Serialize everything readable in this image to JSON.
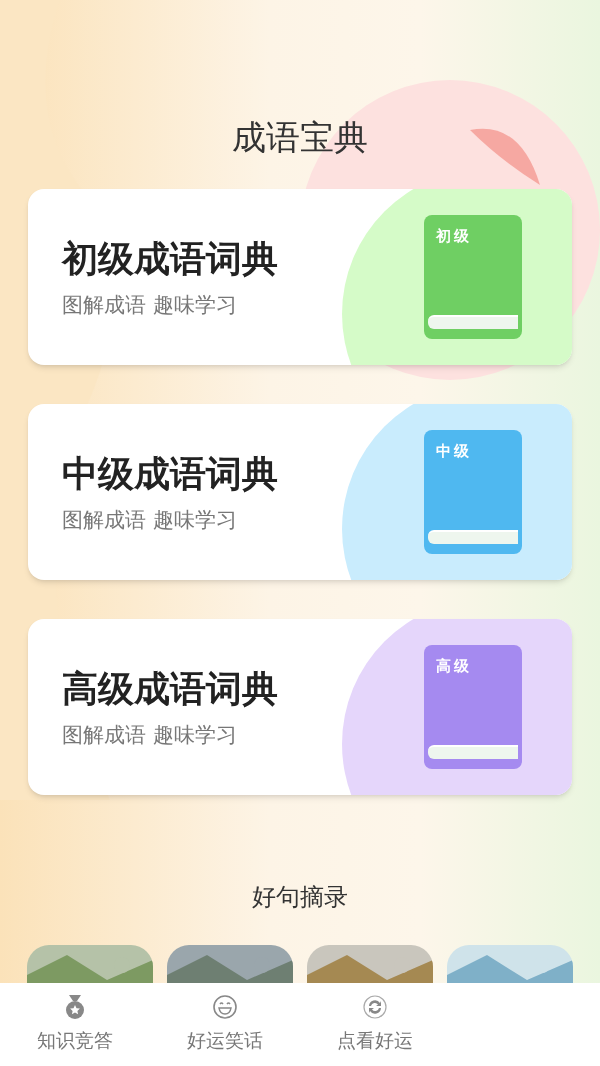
{
  "title": "成语宝典",
  "cards": [
    {
      "title": "初级成语词典",
      "subtitle": "图解成语 趣味学习",
      "book_label": "初级",
      "color": "#6fcf63"
    },
    {
      "title": "中级成语词典",
      "subtitle": "图解成语 趣味学习",
      "book_label": "中级",
      "color": "#4fb8f0"
    },
    {
      "title": "高级成语词典",
      "subtitle": "图解成语 趣味学习",
      "book_label": "高级",
      "color": "#a58af0"
    }
  ],
  "section_title": "好句摘录",
  "tabs": [
    {
      "label": "知识竞答",
      "kind": "medal"
    },
    {
      "label": "好运笑话",
      "kind": "smile"
    },
    {
      "label": "点看好运",
      "kind": "refresh"
    }
  ]
}
